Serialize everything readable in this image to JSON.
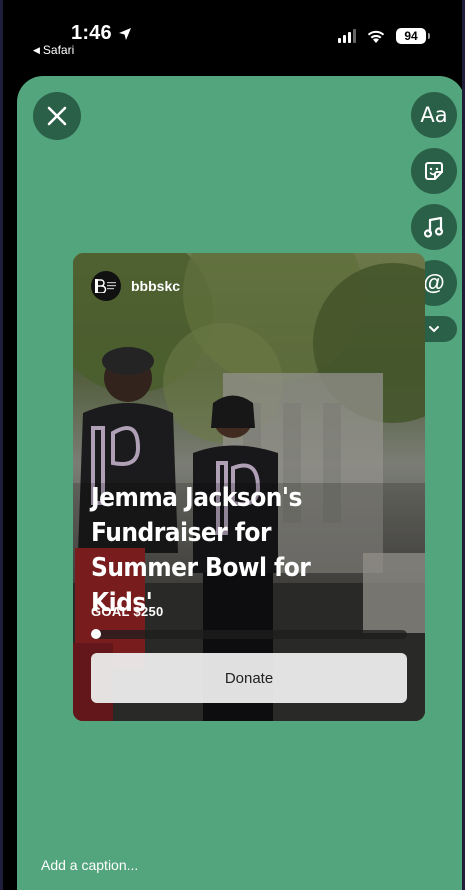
{
  "status_bar": {
    "time": "1:46",
    "back_label": "Safari",
    "battery": "94"
  },
  "toolbar": {
    "close_icon": "close-icon",
    "text_label": "Aa",
    "sticker_icon": "sticker-icon",
    "music_icon": "music-icon",
    "mention_label": "@",
    "more_icon": "chevron-down-icon"
  },
  "card": {
    "username": "bbbskc",
    "title_lines": [
      "Jemma Jackson's",
      "Fundraiser for",
      "Summer Bowl for Kids'"
    ],
    "goal_label": "GOAL $250",
    "progress": 0,
    "donate_label": "Donate"
  },
  "caption": {
    "placeholder": "Add a caption..."
  },
  "colors": {
    "background": "#52a57d",
    "tool_button": "#0a281c"
  }
}
